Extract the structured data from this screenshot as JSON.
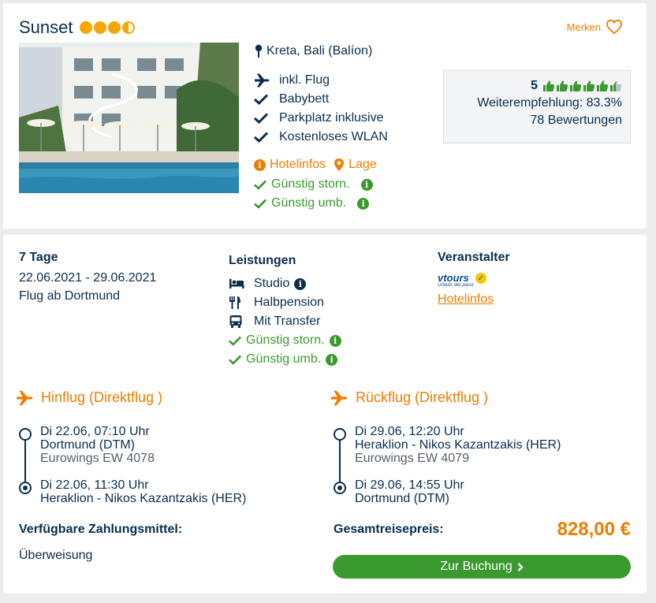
{
  "hotel": {
    "name": "Sunset",
    "stars": 3.5,
    "merken_label": "Merken",
    "location": "Kreta, Bali (Balíon)",
    "features": [
      "inkl. Flug",
      "Babybett",
      "Parkplatz inklusive",
      "Kostenloses WLAN"
    ],
    "links": {
      "hotelinfos": "Hotelinfos",
      "lage": "Lage"
    },
    "benefits": [
      "Günstig storn.",
      "Günstig umb."
    ],
    "rating": {
      "score": "5",
      "thumbs_filled": 5.5,
      "thumbs_total": 6,
      "recommendation": "Weiterempfehlung: 83.3%",
      "reviews": "78 Bewertungen"
    }
  },
  "offer": {
    "duration": "7 Tage",
    "dates": "22.06.2021 - 29.06.2021",
    "departure": "Flug ab Dortmund",
    "leistungen_head": "Leistungen",
    "leistungen": [
      "Studio",
      "Halbpension",
      "Mit Transfer"
    ],
    "leistungen_benefits": [
      "Günstig storn.",
      "Günstig umb."
    ],
    "veranstalter_head": "Veranstalter",
    "veranstalter_logo": {
      "word": "vtours",
      "tagline": "Urlaub, der passt"
    },
    "veranstalter_link": "Hotelinfos"
  },
  "flights": {
    "outbound": {
      "title": "Hinflug (Direktflug )",
      "dep_time": "Di 22.06, 07:10 Uhr",
      "dep_airport": "Dortmund (DTM)",
      "airline": "Eurowings EW 4078",
      "arr_time": "Di 22.06, 11:30 Uhr",
      "arr_airport": "Heraklion - Nikos Kazantzakis (HER)"
    },
    "return": {
      "title": "Rückflug (Direktflug )",
      "dep_time": "Di 29.06, 12:20 Uhr",
      "dep_airport": "Heraklion - Nikos Kazantzakis (HER)",
      "airline": "Eurowings EW 4079",
      "arr_time": "Di 29.06, 14:55 Uhr",
      "arr_airport": "Dortmund (DTM)"
    }
  },
  "payment": {
    "label": "Verfügbare Zahlungsmittel:",
    "method": "Überweisung"
  },
  "price": {
    "label": "Gesamtreisepreis:",
    "value": "828,00 €"
  },
  "booking": {
    "button_label": "Zur Buchung"
  },
  "colors": {
    "navy": "#0b2d4e",
    "orange": "#f07d00",
    "green": "#3a9a2f",
    "star": "#f7a600"
  }
}
